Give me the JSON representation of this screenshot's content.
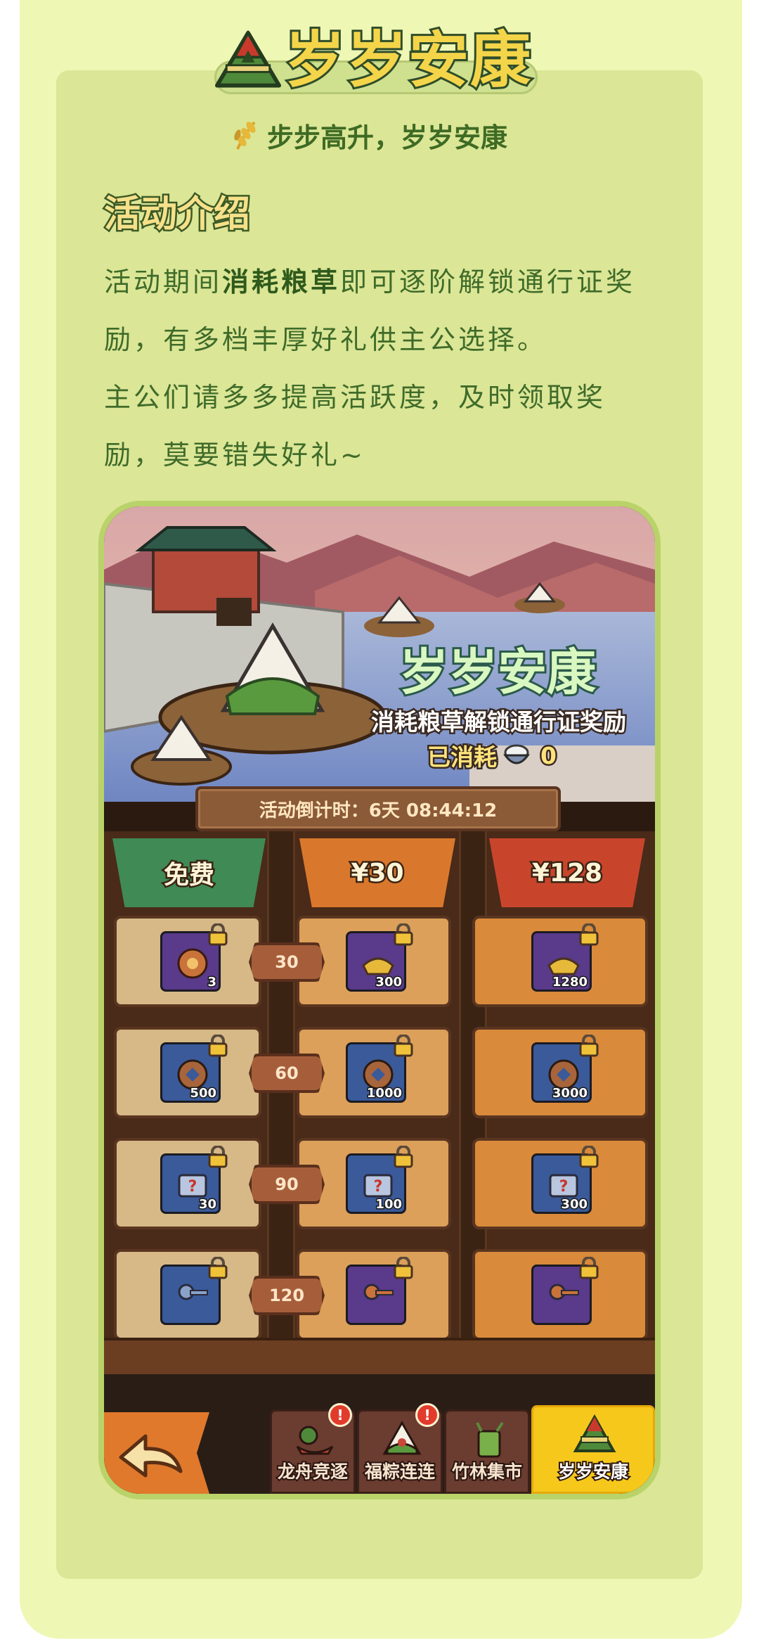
{
  "header": {
    "title": "岁岁安康",
    "subtitle": "步步高升，岁岁安康"
  },
  "section": {
    "title": "活动介绍",
    "para1_pre": "活动期间",
    "para1_bold": "消耗粮草",
    "para1_post": "即可逐阶解锁通行证奖励，有多档丰厚好礼供主公选择。",
    "para2": "主公们请多多提高活跃度，及时领取奖励，莫要错失好礼~"
  },
  "game": {
    "banner_title": "岁岁安康",
    "banner_desc": "消耗粮草解锁通行证奖励",
    "consumed_label": "已消耗",
    "consumed_value": "0",
    "countdown": "活动倒计时：6天 08:44:12",
    "tiers": [
      "免费",
      "¥30",
      "¥128"
    ],
    "rows": [
      {
        "level": "30",
        "free_qty": "3",
        "t30_qty": "300",
        "t128_qty": "1280"
      },
      {
        "level": "60",
        "free_qty": "500",
        "t30_qty": "1000",
        "t128_qty": "3000"
      },
      {
        "level": "90",
        "free_qty": "30",
        "t30_qty": "100",
        "t128_qty": "300"
      },
      {
        "level": "120",
        "free_qty": "",
        "t30_qty": "",
        "t128_qty": ""
      }
    ],
    "nav": [
      "龙舟竞逐",
      "福粽连连",
      "竹林集市",
      "岁岁安康"
    ],
    "nav_alert": "!"
  },
  "colors": {
    "page_bg": "#eff7b4",
    "card_bg": "#dbe696",
    "text_green": "#3f6b2a",
    "title_yellow": "#f4d54a",
    "free_tab": "#3f8a55",
    "tier30_tab": "#d9782c",
    "tier128_tab": "#c8452c",
    "active_nav": "#f7c81c"
  },
  "icons": [
    "zongzi-icon",
    "wheat-icon",
    "lock-icon",
    "back-arrow-icon",
    "dragon-boat-icon",
    "rice-ball-icon",
    "bamboo-icon"
  ]
}
